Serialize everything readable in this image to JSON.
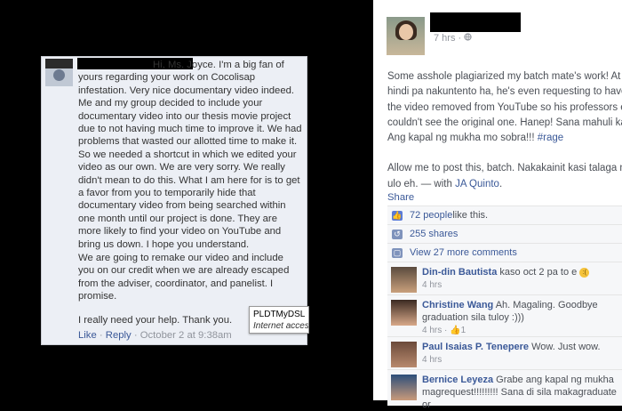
{
  "message_panel": {
    "paragraph1": "Hi, Ms. Joyce. I'm a big fan of yours regarding your work on Cocolisap infestation. Very nice documentary video indeed. Me and my group decided to include your documentary video into our thesis movie project due to not having much time to improve it. We had problems that wasted our allotted time to make it. So we needed a shortcut in which we edited your video as our own. We are very sorry. We really didn't mean to do this. What I am here for is to get a favor from you to temporarily hide that documentary video from being searched within one month until our project is done. They are more likely to find your video on YouTube and bring us down. I hope you understand.",
    "paragraph2": "We are going to remake our video and include you on our credit when we are already escaped from the adviser, coordinator, and panelist. I promise.",
    "paragraph3": "I really need your help. Thank you.",
    "like_label": "Like",
    "reply_label": "Reply",
    "separator": "·",
    "timestamp": "October 2 at 9:38am",
    "tooltip_title": "PLDTMyDSL",
    "tooltip_sub": "Internet acces"
  },
  "post": {
    "time": "7 hrs · ",
    "line1": "Some asshole plagiarized my batch mate's work! At",
    "line2": "hindi pa nakuntento ha, he's even requesting to have",
    "line3": "the video removed from YouTube so his professors et",
    "line4": "couldn't see the original one. Hanep! Sana mahuli ka!",
    "line5_text": "Ang kapal ng mukha mo sobra!!! ",
    "hashtag": "#rage",
    "line6": "Allow me to post this, batch. Nakakainit kasi talaga n",
    "line7_text": "ulo eh. — with ",
    "tagged_name": "JA Quinto",
    "line7_end": ".",
    "share_label": "Share"
  },
  "stats": {
    "likes_link": "72 people",
    "likes_suffix": " like this.",
    "shares": "255 shares",
    "view_more": "View 27 more comments"
  },
  "comments": [
    {
      "name": "Din-din Bautista",
      "text": " kaso oct 2 pa to e ",
      "meta": "4 hrs",
      "likes": ""
    },
    {
      "name": "Christine Wang",
      "text": " Ah. Magaling. Goodbye graduation sila tuloy :)))",
      "meta": "4 hrs · ",
      "likes": "1"
    },
    {
      "name": "Paul Isaias P. Tenepere",
      "text": " Wow. Just wow.",
      "meta": "4 hrs",
      "likes": ""
    },
    {
      "name": "Bernice Leyeza",
      "text": " Grabe ang kapal ng mukha magrequest!!!!!!!!! Sana di sila makagraduate or",
      "meta": "",
      "likes": ""
    }
  ],
  "colors": {
    "link": "#3b5998",
    "background": "#000000",
    "panel": "#eceff5"
  }
}
